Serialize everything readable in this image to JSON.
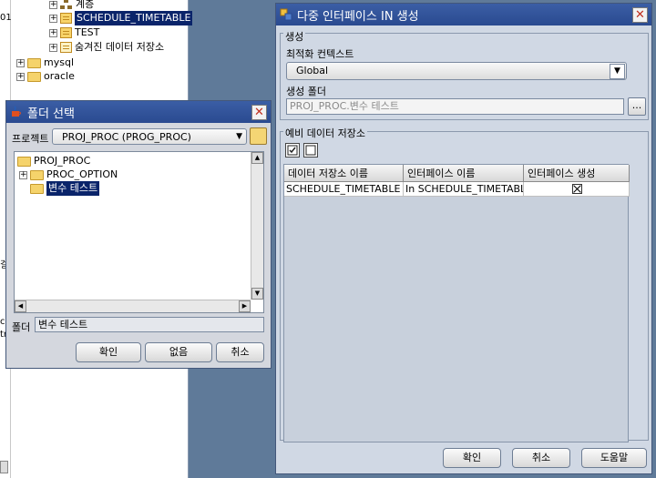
{
  "background_tree": {
    "items": [
      {
        "label": "계층",
        "expander": "+",
        "icon": "hierarchy-icon"
      },
      {
        "label": "SCHEDULE_TIMETABLE",
        "expander": "+",
        "icon": "table-icon",
        "selected": true
      },
      {
        "label": "TEST",
        "expander": "+",
        "icon": "table-icon"
      },
      {
        "label": "숨겨진 데이터 저장소",
        "expander": "+",
        "icon": "hidden-store-icon"
      },
      {
        "label": "mysql",
        "expander": "+",
        "icon": "folder-icon"
      },
      {
        "label": "oracle",
        "expander": "+",
        "icon": "folder-icon"
      }
    ],
    "edge_fragments": [
      "01",
      "걸",
      "cı",
      "tr"
    ]
  },
  "folder_dialog": {
    "title": "폴더 선택",
    "project_label": "프로젝트",
    "project_value": "PROJ_PROC (PROG_PROC)",
    "tree": {
      "root": "PROJ_PROC",
      "children": [
        {
          "label": "PROC_OPTION",
          "expander": "+"
        },
        {
          "label": "변수 테스트",
          "selected": true
        }
      ]
    },
    "folder_label": "폴더",
    "folder_value": "변수 테스트",
    "buttons": {
      "ok": "확인",
      "none": "없음",
      "cancel": "취소"
    }
  },
  "main_dialog": {
    "title": "다중 인터페이스 IN 생성",
    "create_group": "생성",
    "optimize_context_label": "최적화 컨텍스트",
    "optimize_context_value": "Global",
    "create_folder_label": "생성 폴더",
    "create_folder_value": "PROJ_PROC.변수 테스트",
    "browse_label": "...",
    "spare_group": "예비 데이터 저장소",
    "table": {
      "headers": [
        "데이터 저장소 이름",
        "인터페이스 이름",
        "인터페이스 생성"
      ],
      "rows": [
        {
          "store": "SCHEDULE_TIMETABLE",
          "interface": "In SCHEDULE_TIMETABLE ...",
          "create": true
        }
      ]
    },
    "buttons": {
      "ok": "확인",
      "cancel": "취소",
      "help": "도움말"
    }
  },
  "colors": {
    "title_bar": "#2f52a0",
    "selection": "#0a246a",
    "desktop": "#5f7a99"
  }
}
